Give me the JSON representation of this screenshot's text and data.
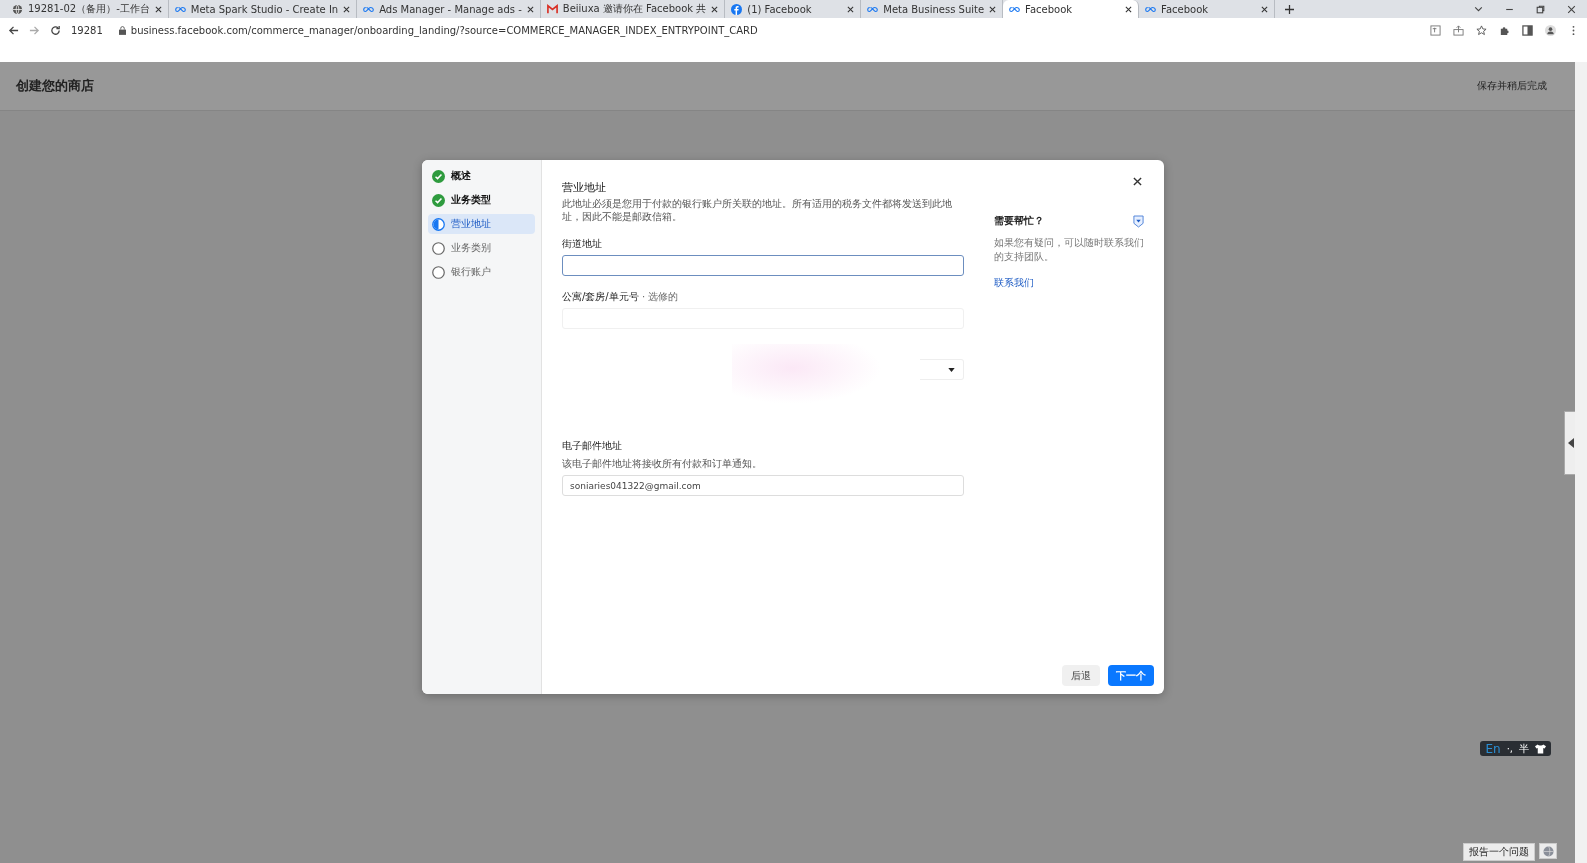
{
  "browser": {
    "tabs": [
      {
        "kind": "globe",
        "title": "19281-02（备用）-工作台",
        "selected": false
      },
      {
        "kind": "meta",
        "title": "Meta Spark Studio - Create In",
        "selected": false
      },
      {
        "kind": "meta",
        "title": "Ads Manager - Manage ads -",
        "selected": false
      },
      {
        "kind": "mail",
        "title": "Beiiuxa 邀请你在 Facebook 共",
        "selected": false
      },
      {
        "kind": "facebook",
        "title": "(1) Facebook",
        "selected": false
      },
      {
        "kind": "meta",
        "title": "Meta Business Suite",
        "selected": false
      },
      {
        "kind": "meta",
        "title": "Facebook",
        "selected": true
      },
      {
        "kind": "meta",
        "title": "Facebook",
        "selected": false
      }
    ],
    "profile_label": "19281",
    "url": "business.facebook.com/commerce_manager/onboarding_landing/?source=COMMERCE_MANAGER_INDEX_ENTRYPOINT_CARD"
  },
  "page": {
    "title": "创建您的商店",
    "save_later": "保存并稍后完成"
  },
  "dialog": {
    "steps": [
      {
        "label": "概述",
        "completed": true,
        "selected": false
      },
      {
        "label": "业务类型",
        "completed": true,
        "selected": false
      },
      {
        "label": "营业地址",
        "completed": false,
        "selected": true
      },
      {
        "label": "业务类别",
        "completed": false,
        "selected": false
      },
      {
        "label": "银行账户",
        "completed": false,
        "selected": false
      }
    ],
    "title": "营业地址",
    "description": "此地址必须是您用于付款的银行账户所关联的地址。所有适用的税务文件都将发送到此地址，因此不能是邮政信箱。",
    "street": {
      "label": "街道地址"
    },
    "apartment": {
      "label": "公寓/套房/单元号",
      "optional": "· 选修的"
    },
    "email": {
      "label": "电子邮件地址",
      "hint": "该电子邮件地址将接收所有付款和订单通知。",
      "value": "soniaries041322@gmail.com"
    },
    "help": {
      "title": "需要帮忙？",
      "text": "如果您有疑问，可以随时联系我们的支持团队。",
      "link": "联系我们"
    },
    "back": "后退",
    "next": "下一个"
  },
  "ime": {
    "mode": "En",
    "punct": "·,",
    "width": "半"
  },
  "report": "报告一个问题"
}
